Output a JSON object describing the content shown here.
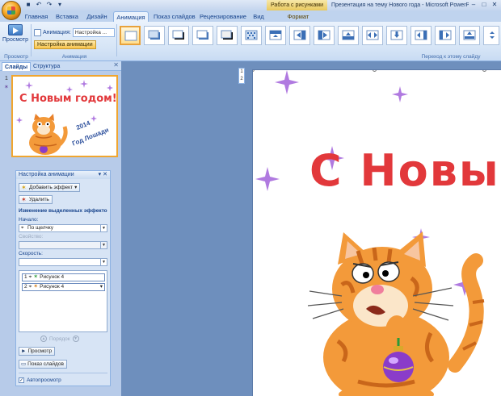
{
  "window": {
    "title": "Презентация на тему Нового года - Microsoft PowerPoint",
    "context_tab": "Работа с рисунками"
  },
  "tabs": [
    "Главная",
    "Вставка",
    "Дизайн",
    "Анимация",
    "Показ слайдов",
    "Рецензирование",
    "Вид",
    "Формат"
  ],
  "active_tab": "Анимация",
  "ribbon": {
    "preview_label": "Просмотр",
    "animation_label": "Анимация:",
    "animation_value": "Настройка ...",
    "custom_animation_label": "Настройка анимации",
    "groups": {
      "preview": "Просмотр",
      "animation": "Анимация",
      "transition": "Переход к этому слайду"
    }
  },
  "left_pane": {
    "tabs": [
      "Слайды",
      "Структура"
    ],
    "slide_number": "1",
    "thumbnail": {
      "title": "С Новым годом!",
      "year": "2014",
      "subtitle": "Год Лошади"
    }
  },
  "task_pane": {
    "title": "Настройка анимации",
    "add_effect": "Добавить эффект",
    "remove": "Удалить",
    "modify_heading": "Изменение выделенных эффекто",
    "start_label": "Начало:",
    "start_value": "По щелчку",
    "property_label": "Свойство:",
    "speed_label": "Скорость:",
    "items": [
      {
        "num": "1",
        "name": "Рисунок 4"
      },
      {
        "num": "2",
        "name": "Рисунок 4"
      }
    ],
    "reorder_label": "Порядок",
    "play_button": "Просмотр",
    "slideshow_button": "Показ слайдов",
    "autopreview_label": "Автопросмотр",
    "autopreview_checked": true
  },
  "ruler_marks": [
    "1",
    "2"
  ],
  "slide": {
    "title": "С Новым"
  },
  "colors": {
    "accent_title": "#e2383b",
    "ribbon_bg": "#d5e4f6",
    "workspace_bg": "#6e8fbd"
  }
}
